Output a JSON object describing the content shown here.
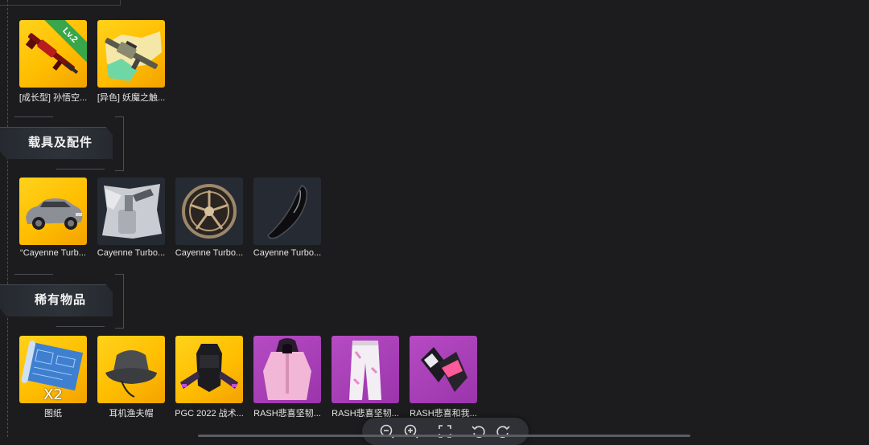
{
  "sections": {
    "weapons": {
      "items": [
        {
          "label": "[成长型] 孙悟空...",
          "badge": "Lv.2",
          "icon": "red-rifle-icon",
          "bg": "gold"
        },
        {
          "label": "[异色] 妖魔之触...",
          "icon": "camo-rifle-icon",
          "bg": "gold"
        }
      ]
    },
    "vehicles": {
      "title": "载具及配件",
      "items": [
        {
          "label": "“Cayenne Turb...",
          "icon": "suv-car-icon",
          "bg": "gold"
        },
        {
          "label": "Cayenne Turbo...",
          "icon": "paint-spray-icon",
          "bg": "dark"
        },
        {
          "label": "Cayenne Turbo...",
          "icon": "car-wheel-icon",
          "bg": "dark"
        },
        {
          "label": "Cayenne Turbo...",
          "icon": "car-part-icon",
          "bg": "dark"
        }
      ]
    },
    "rare": {
      "title": "稀有物品",
      "items": [
        {
          "label": "图纸",
          "qty": "X2",
          "icon": "blueprint-icon",
          "bg": "gold"
        },
        {
          "label": "耳机渔夫帽",
          "icon": "bucket-hat-icon",
          "bg": "gold"
        },
        {
          "label": "PGC 2022 战术...",
          "icon": "tactical-vest-icon",
          "bg": "gold"
        },
        {
          "label": "RASH悲喜坚韧...",
          "icon": "hoodie-icon",
          "bg": "purple"
        },
        {
          "label": "RASH悲喜坚韧...",
          "icon": "pants-icon",
          "bg": "purple"
        },
        {
          "label": "RASH悲喜和我...",
          "icon": "gloves-icon",
          "bg": "purple"
        }
      ]
    }
  },
  "colors": {
    "gold": "#ffc800",
    "purple": "#a63fb6",
    "dark": "#262b33",
    "background": "#1c1c1e"
  },
  "toolbar": {
    "buttons": [
      "zoom-out-icon",
      "zoom-in-icon",
      "fullscreen-icon",
      "rotate-left-icon",
      "rotate-right-icon"
    ]
  }
}
